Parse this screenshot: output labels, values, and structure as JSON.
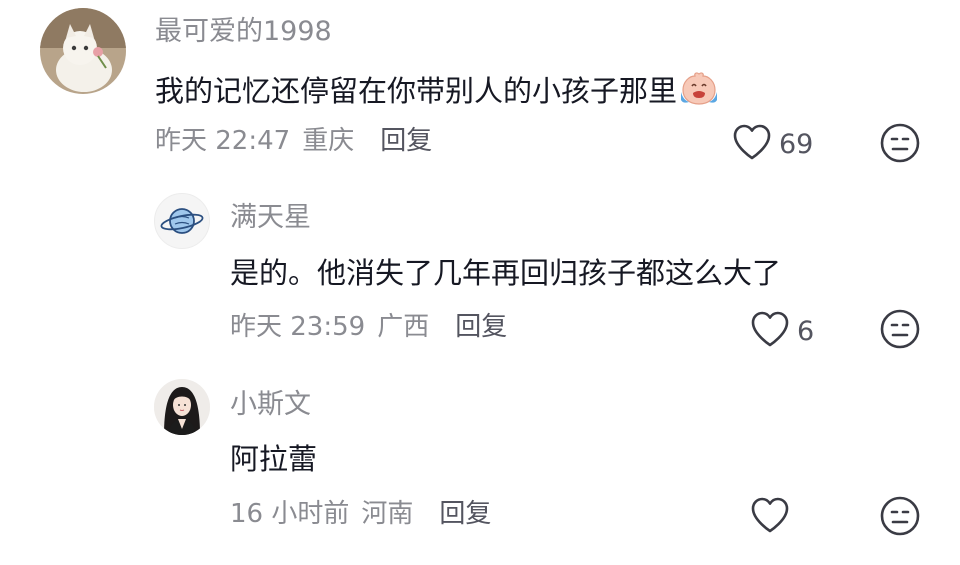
{
  "comments": [
    {
      "username": "最可爱的1998",
      "text": "我的记忆还停留在你带别人的小孩子那里",
      "emoji": "crying-face-emoji",
      "time": "昨天 22:47",
      "location": "重庆",
      "reply_label": "回复",
      "likes": "69"
    },
    {
      "username": "满天星",
      "text": "是的。他消失了几年再回归孩子都这么大了",
      "time": "昨天 23:59",
      "location": "广西",
      "reply_label": "回复",
      "likes": "6"
    },
    {
      "username": "小斯文",
      "text": "阿拉蕾",
      "time": "16 小时前",
      "location": "河南",
      "reply_label": "回复",
      "likes": ""
    }
  ],
  "icons": {
    "like": "heart-outline-icon",
    "dislike": "neutral-face-icon"
  },
  "colors": {
    "text": "#161823",
    "secondary": "#8a8b91",
    "action": "#545560"
  }
}
